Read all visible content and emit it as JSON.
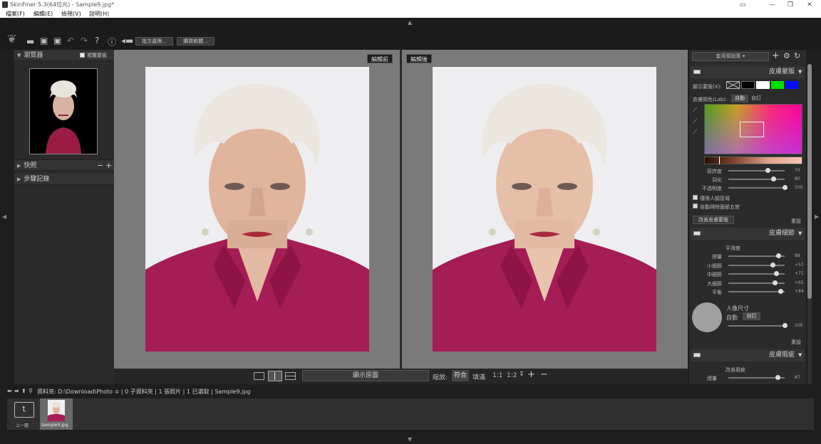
{
  "window": {
    "title": "SkinFiner 5.3(64位元) - Sample9.jpg*"
  },
  "menu": [
    "檔案(F)",
    "編輯(E)",
    "檢視(V)",
    "說明(H)"
  ],
  "toolbar": {
    "batch_label": "批次處理...",
    "buy_label": "購買軟體..."
  },
  "left": {
    "navigator_title": "瀏覽器",
    "preview_mask_label": "預覽蒙板",
    "snapshot_title": "快照",
    "history_title": "步驟記錄"
  },
  "center": {
    "before_label": "編輯前",
    "after_label": "編輯後",
    "show_original_label": "顯示原圖",
    "zoom_label": "縮放:",
    "fit_label": "符合",
    "fill_label": "填滿",
    "ratio_1": "1:1",
    "ratio_2": "1:2"
  },
  "right": {
    "preset_label": "套用預設集",
    "skin_mask": {
      "title": "皮膚蒙版",
      "show_mask_label": "顯示蒙版(X):",
      "skin_color_label": "皮膚顏色(Lab):",
      "auto_label": "自動",
      "custom_label": "自訂",
      "sliders": [
        {
          "label": "容許度",
          "value": "70",
          "level": 0.7
        },
        {
          "label": "羽化",
          "value": "80",
          "level": 0.8
        },
        {
          "label": "不透明度",
          "value": "100",
          "level": 1.0
        }
      ],
      "check1": "僅限人臉區域",
      "check2": "自動排除面部五官",
      "improve_label": "改善皮膚蒙版",
      "reset_label": "重設"
    },
    "skin_detail": {
      "title": "皮膚細節",
      "smooth_title": "平滑度",
      "sliders": [
        {
          "label": "總量",
          "value": "88",
          "level": 0.88
        },
        {
          "label": "小細節",
          "value": "+57",
          "level": 0.78
        },
        {
          "label": "中細節",
          "value": "+71",
          "level": 0.85
        },
        {
          "label": "大細節",
          "value": "+65",
          "level": 0.82
        },
        {
          "label": "平衡",
          "value": "+84",
          "level": 0.92
        }
      ],
      "portrait_size_label": "人像尺寸",
      "auto_label": "自動",
      "custom_label": "自訂",
      "size_value": "100",
      "size_level": 1.0,
      "reset_label": "重設"
    },
    "skin_defect": {
      "title": "皮膚瑕疵",
      "sub": "改善瑕疵",
      "slider_label": "總量",
      "slider_value": "87",
      "slider_level": 0.87
    }
  },
  "pathbar": {
    "text": "資料夾: D:\\Download\\Photo ≑ | 0 子資料夾 | 1 張照片 | 1 已選取 | Sample9.jpg"
  },
  "filmstrip": {
    "up_label": "上一層",
    "file_label": "Sample9.jpg"
  }
}
